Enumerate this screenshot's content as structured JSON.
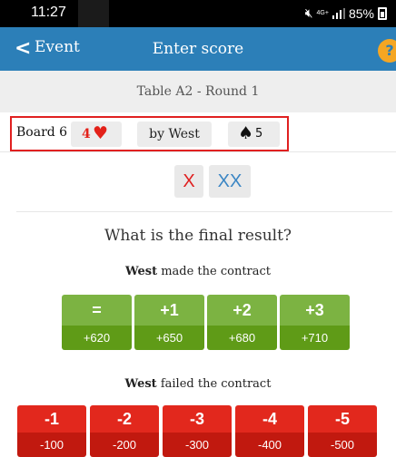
{
  "status": {
    "time": "11:27",
    "network": "4G+",
    "battery": "85%"
  },
  "appbar": {
    "back_label": "Event",
    "title": "Enter score",
    "help": "?"
  },
  "subheader": {
    "text": "Table A2  -  Round 1"
  },
  "summary": {
    "board": "Board 6",
    "contract_level": "4",
    "contract_suit": "♥",
    "declarer": "by West",
    "lead_suit": "♠",
    "lead_card": "5"
  },
  "doubles": {
    "double": "X",
    "redouble": "XX"
  },
  "question": "What is the final result?",
  "made": {
    "player": "West",
    "text": " made the contract",
    "options": [
      {
        "label": "=",
        "score": "+620"
      },
      {
        "label": "+1",
        "score": "+650"
      },
      {
        "label": "+2",
        "score": "+680"
      },
      {
        "label": "+3",
        "score": "+710"
      }
    ]
  },
  "failed": {
    "player": "West",
    "text": " failed the contract",
    "options": [
      {
        "label": "-1",
        "score": "-100"
      },
      {
        "label": "-2",
        "score": "-200"
      },
      {
        "label": "-3",
        "score": "-300"
      },
      {
        "label": "-4",
        "score": "-400"
      },
      {
        "label": "-5",
        "score": "-500"
      }
    ]
  },
  "colors": {
    "appbar": "#2c7fb8",
    "made_top": "#7cb342",
    "made_bottom": "#5f9b17",
    "failed_top": "#e2281d",
    "failed_bottom": "#c1190f",
    "highlight_border": "#e02020"
  }
}
